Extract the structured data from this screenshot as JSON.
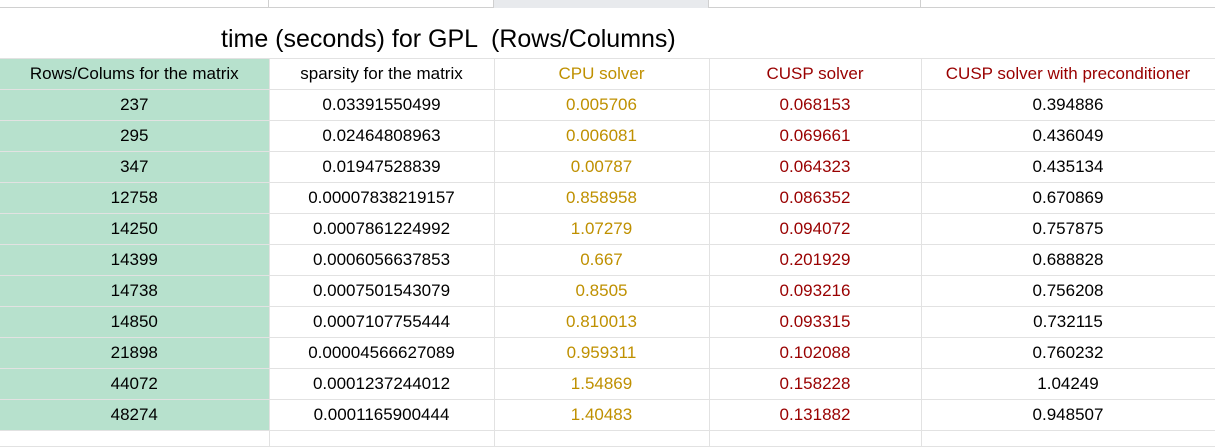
{
  "title": "time (seconds) for GPL  (Rows/Columns)",
  "colors": {
    "rows_column_bg": "#b7e1cd",
    "cpu_text": "#bf9000",
    "cusp_text": "#990000",
    "gridline": "#e2e2e2"
  },
  "headers": {
    "rows": "Rows/Colums for the matrix",
    "sparsity": "sparsity for the matrix",
    "cpu": "CPU solver",
    "cusp": "CUSP solver",
    "cusp_pre": "CUSP solver with preconditioner"
  },
  "rows": [
    {
      "rows": "237",
      "sparsity": "0.03391550499",
      "cpu": "0.005706",
      "cusp": "0.068153",
      "cusp_pre": "0.394886"
    },
    {
      "rows": "295",
      "sparsity": "0.02464808963",
      "cpu": "0.006081",
      "cusp": "0.069661",
      "cusp_pre": "0.436049"
    },
    {
      "rows": "347",
      "sparsity": "0.01947528839",
      "cpu": "0.00787",
      "cusp": "0.064323",
      "cusp_pre": "0.435134"
    },
    {
      "rows": "12758",
      "sparsity": "0.00007838219157",
      "cpu": "0.858958",
      "cusp": "0.086352",
      "cusp_pre": "0.670869"
    },
    {
      "rows": "14250",
      "sparsity": "0.0007861224992",
      "cpu": "1.07279",
      "cusp": "0.094072",
      "cusp_pre": "0.757875"
    },
    {
      "rows": "14399",
      "sparsity": "0.0006056637853",
      "cpu": "0.667",
      "cusp": "0.201929",
      "cusp_pre": "0.688828"
    },
    {
      "rows": "14738",
      "sparsity": "0.0007501543079",
      "cpu": "0.8505",
      "cusp": "0.093216",
      "cusp_pre": "0.756208"
    },
    {
      "rows": "14850",
      "sparsity": "0.0007107755444",
      "cpu": "0.810013",
      "cusp": "0.093315",
      "cusp_pre": "0.732115"
    },
    {
      "rows": "21898",
      "sparsity": "0.00004566627089",
      "cpu": "0.959311",
      "cusp": "0.102088",
      "cusp_pre": "0.760232"
    },
    {
      "rows": "44072",
      "sparsity": "0.0001237244012",
      "cpu": "1.54869",
      "cusp": "0.158228",
      "cusp_pre": "1.04249"
    },
    {
      "rows": "48274",
      "sparsity": "0.0001165900444",
      "cpu": "1.40483",
      "cusp": "0.131882",
      "cusp_pre": "0.948507"
    }
  ]
}
